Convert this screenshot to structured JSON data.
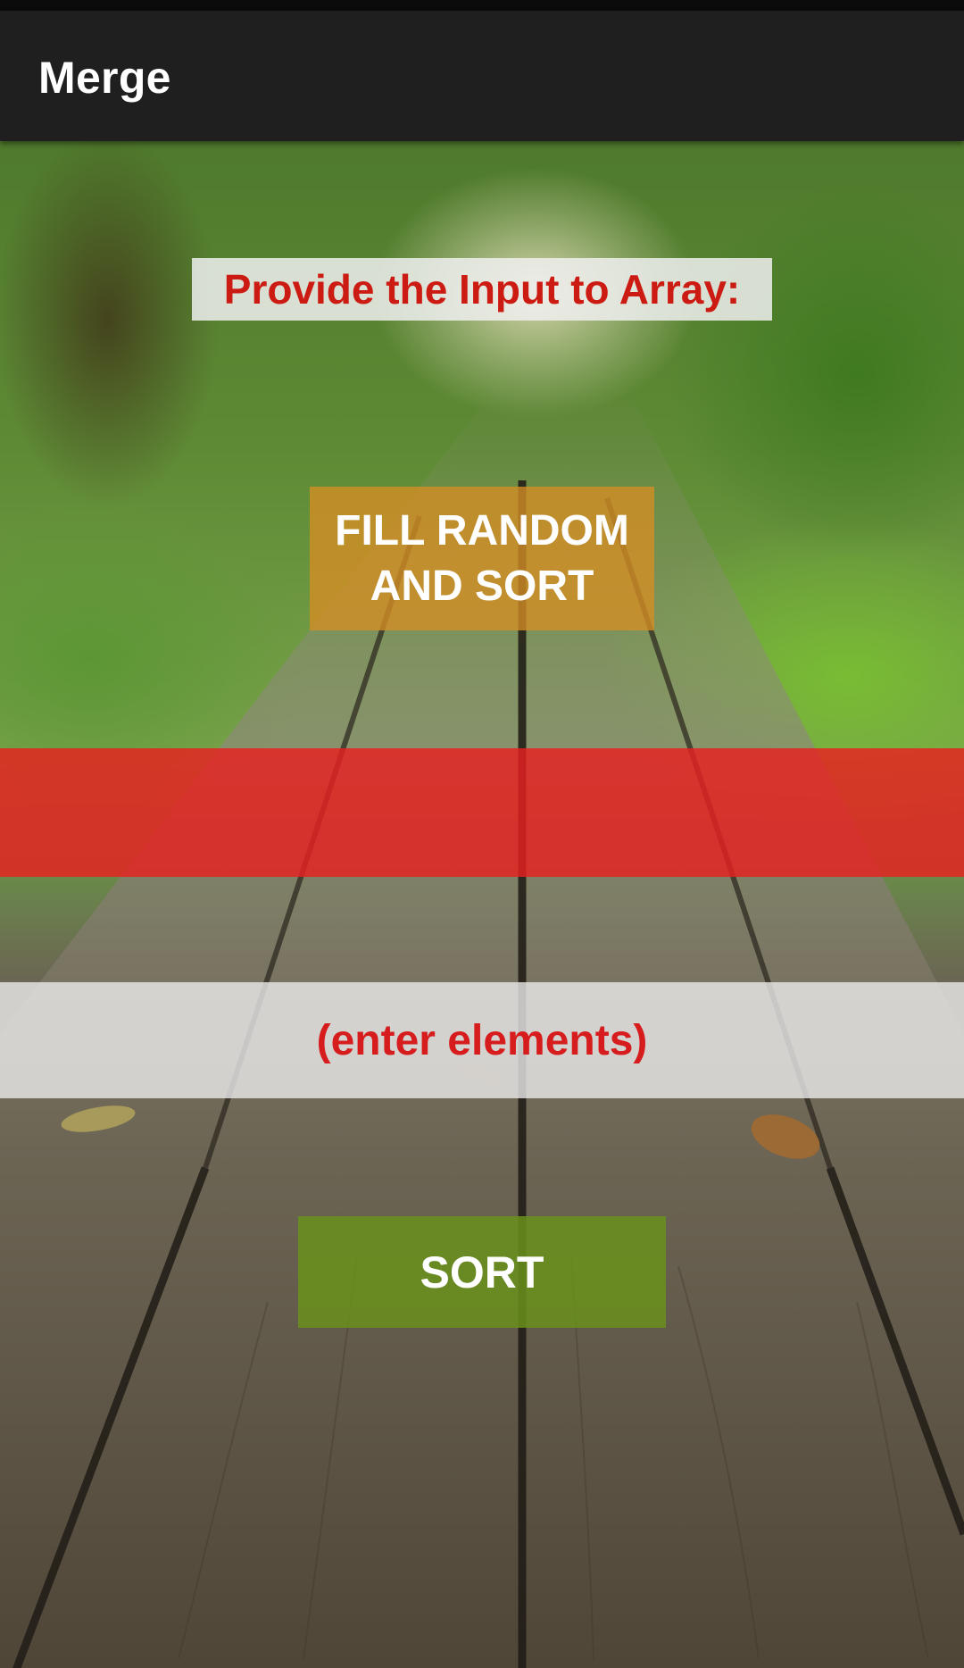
{
  "app_bar": {
    "title": "Merge"
  },
  "main": {
    "prompt_label": "Provide the Input to Array:",
    "fill_random_button_label": "FILL RANDOM AND SORT",
    "result_text": "",
    "elements_input": {
      "value": "",
      "placeholder": "(enter elements)"
    },
    "sort_button_label": "SORT"
  },
  "colors": {
    "app_bar": "#1f1f1f",
    "prompt_text": "#cc1b12",
    "fill_random_button": "#d68e24",
    "result_band": "#e82020",
    "input_text": "#d61c1c",
    "sort_button": "#6a911c"
  }
}
